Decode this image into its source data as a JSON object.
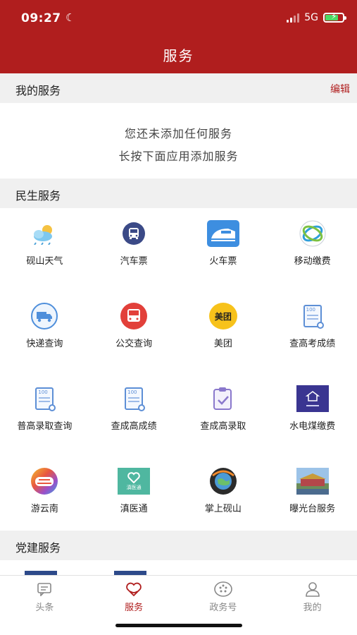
{
  "status_bar": {
    "time": "09:27",
    "network": "5G"
  },
  "header": {
    "title": "服务"
  },
  "my_services": {
    "title": "我的服务",
    "edit_label": "编辑",
    "empty_line1": "您还未添加任何服务",
    "empty_line2": "长按下面应用添加服务"
  },
  "livelihood": {
    "title": "民生服务",
    "items": [
      {
        "label": "砚山天气",
        "icon": "weather-icon"
      },
      {
        "label": "汽车票",
        "icon": "bus-ticket-icon"
      },
      {
        "label": "火车票",
        "icon": "train-icon"
      },
      {
        "label": "移动缴费",
        "icon": "china-mobile-icon"
      },
      {
        "label": "快递查询",
        "icon": "delivery-truck-icon"
      },
      {
        "label": "公交查询",
        "icon": "bus-icon"
      },
      {
        "label": "美团",
        "icon": "meituan-icon",
        "icon_text": "美团"
      },
      {
        "label": "查高考成绩",
        "icon": "exam-score-icon",
        "icon_text": "100"
      },
      {
        "label": "普高录取查询",
        "icon": "admission-query-icon",
        "icon_text": "100"
      },
      {
        "label": "查成高成绩",
        "icon": "adult-exam-score-icon",
        "icon_text": "100"
      },
      {
        "label": "查成高录取",
        "icon": "admission-check-icon"
      },
      {
        "label": "水电煤缴费",
        "icon": "utility-payment-icon"
      },
      {
        "label": "游云南",
        "icon": "you-yunnan-icon"
      },
      {
        "label": "滇医通",
        "icon": "dian-yi-tong-icon",
        "icon_text": "滇医通"
      },
      {
        "label": "掌上砚山",
        "icon": "zhangshang-yanshan-icon"
      },
      {
        "label": "曝光台服务",
        "icon": "exposure-platform-icon"
      }
    ]
  },
  "party": {
    "title": "党建服务"
  },
  "tabbar": {
    "tabs": [
      {
        "label": "头条",
        "icon": "news-icon"
      },
      {
        "label": "服务",
        "icon": "service-heart-icon"
      },
      {
        "label": "政务号",
        "icon": "gov-account-icon"
      },
      {
        "label": "我的",
        "icon": "profile-icon"
      }
    ],
    "active_index": 1
  },
  "colors": {
    "brand_red": "#b01e1e",
    "section_bg": "#f0f0f0"
  }
}
